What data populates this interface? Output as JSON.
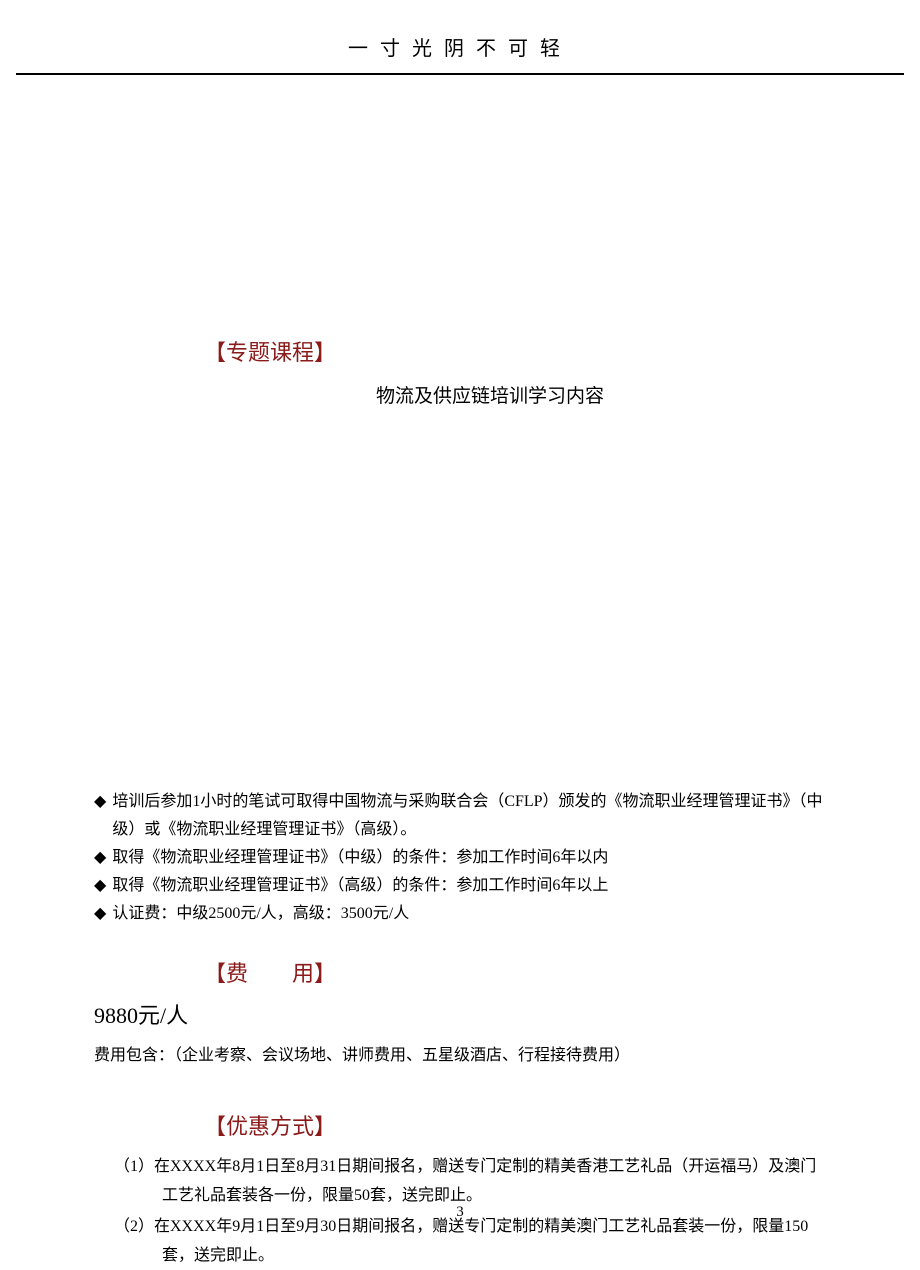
{
  "header": {
    "motto": "一寸光阴不可轻"
  },
  "sections": {
    "topics": {
      "heading": "【专题课程】",
      "subtitle": "物流及供应链培训学习内容"
    },
    "certification": {
      "bullets": [
        "培训后参加1小时的笔试可取得中国物流与采购联合会（CFLP）颁发的《物流职业经理管理证书》（中级）或《物流职业经理管理证书》（高级）。",
        "取得《物流职业经理管理证书》（中级）的条件：参加工作时间6年以内",
        "取得《物流职业经理管理证书》（高级）的条件：参加工作时间6年以上",
        "认证费：中级2500元/人，高级：3500元/人"
      ]
    },
    "fee": {
      "heading": "【费　　用】",
      "price": "9880元/人",
      "includes": "费用包含：（企业考察、会议场地、讲师费用、五星级酒店、行程接待费用）"
    },
    "discount": {
      "heading": "【优惠方式】",
      "items": [
        "（1）在XXXX年8月1日至8月31日期间报名，赠送专门定制的精美香港工艺礼品（开运福马）及澳门工艺礼品套装各一份，限量50套，送完即止。",
        "（2）在XXXX年9月1日至9月30日期间报名，赠送专门定制的精美澳门工艺礼品套装一份，限量150套，送完即止。"
      ]
    }
  },
  "pageNumber": "3"
}
